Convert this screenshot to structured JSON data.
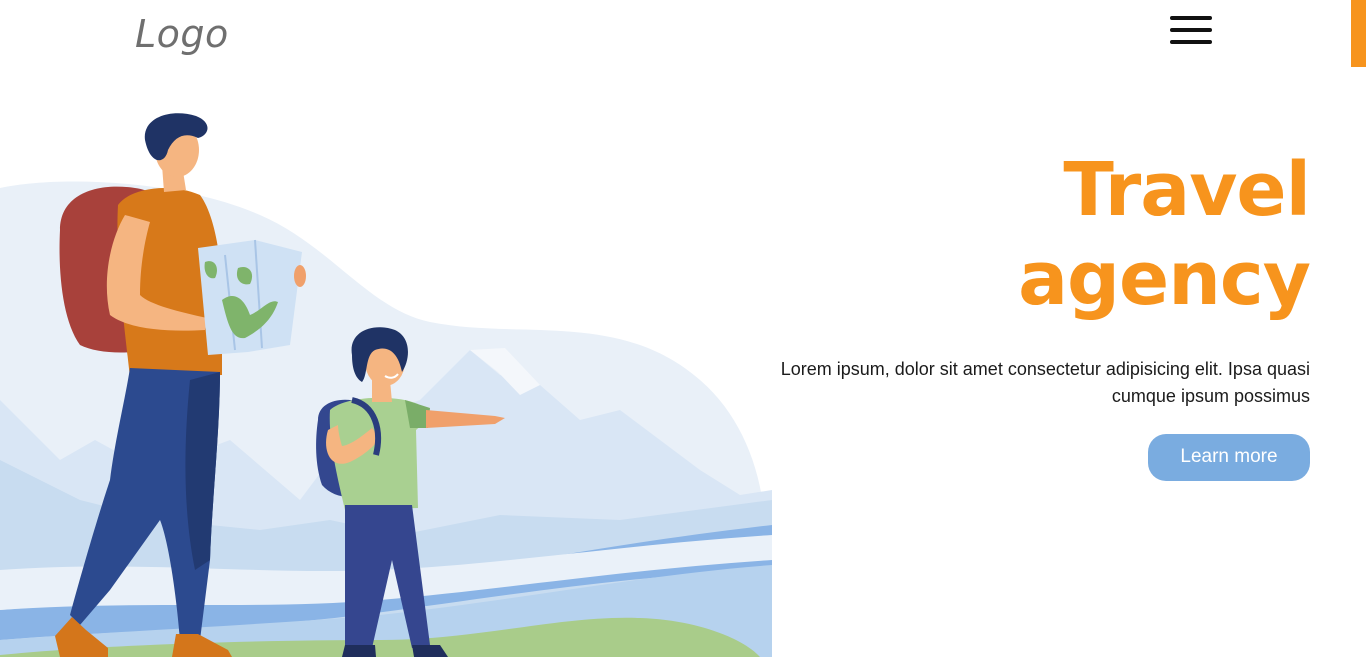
{
  "header": {
    "logo_text": "Logo",
    "menu_icon": "hamburger-menu-icon"
  },
  "hero": {
    "title": "Travel agency",
    "description": "Lorem ipsum, dolor sit amet consectetur adipisicing elit. Ipsa quasi cumque ipsum possimus",
    "button_label": "Learn more"
  },
  "colors": {
    "accent": "#f7941d",
    "button": "#7aace0",
    "text": "#1b1b1b",
    "logo": "#6f6f6f"
  }
}
